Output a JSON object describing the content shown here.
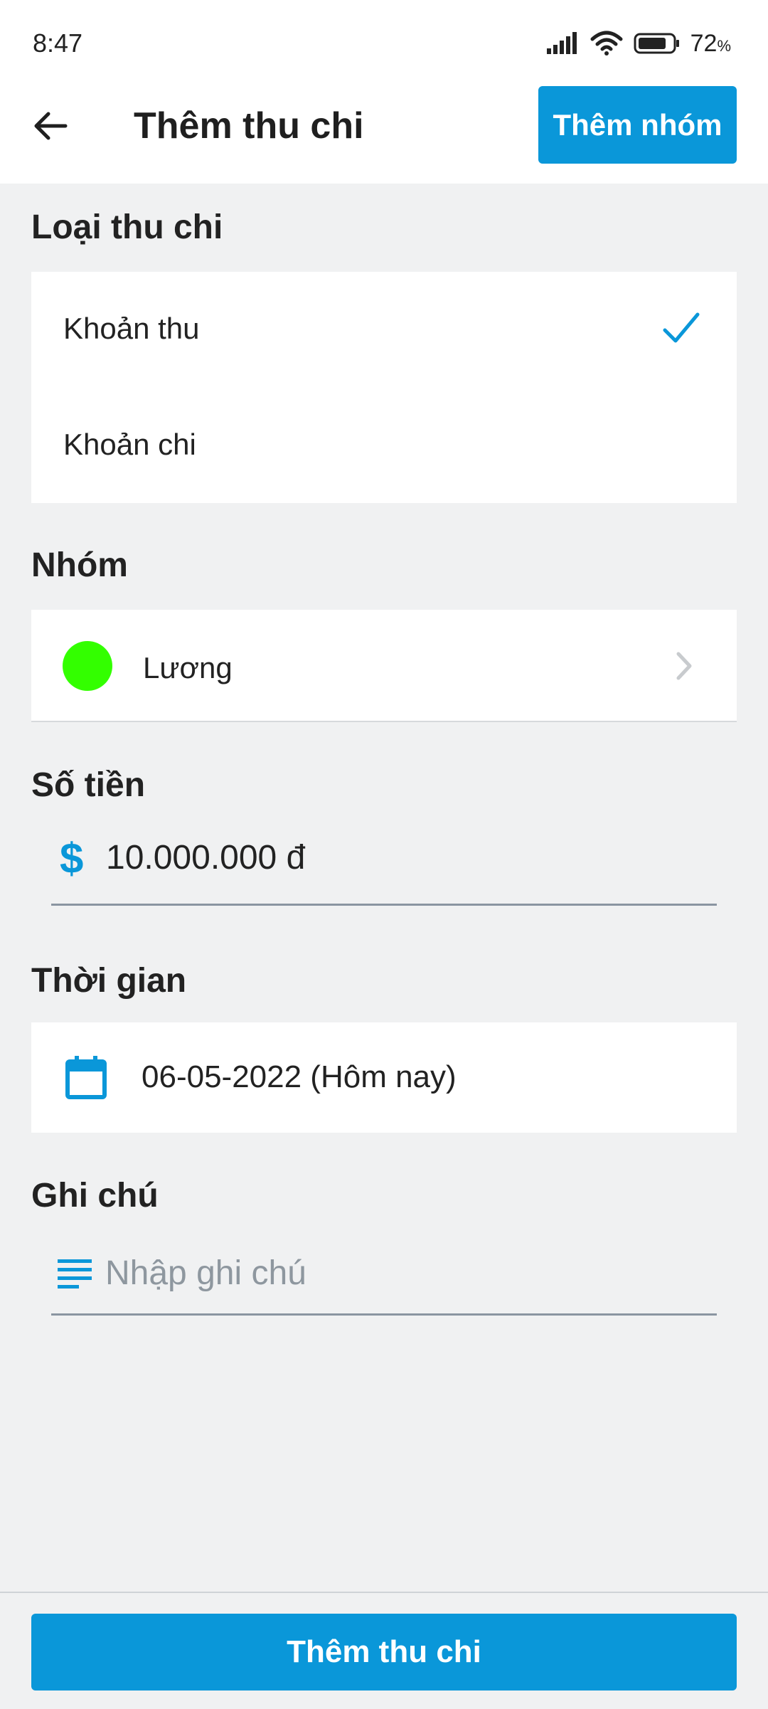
{
  "status_bar": {
    "time": "8:47",
    "battery_percent": "72",
    "battery_unit": "%"
  },
  "app_bar": {
    "title": "Thêm thu chi",
    "add_group_label": "Thêm nhóm"
  },
  "transaction_type": {
    "label": "Loại thu chi",
    "options": [
      {
        "label": "Khoản thu",
        "selected": true
      },
      {
        "label": "Khoản chi",
        "selected": false
      }
    ]
  },
  "group": {
    "label": "Nhóm",
    "name": "Lương",
    "color": "#33ff00"
  },
  "amount": {
    "label": "Số tiền",
    "value": "10.000.000 đ"
  },
  "time": {
    "label": "Thời gian",
    "value": "06-05-2022 (Hôm nay)"
  },
  "note": {
    "label": "Ghi chú",
    "placeholder": "Nhập ghi chú",
    "value": ""
  },
  "submit": {
    "label": "Thêm thu chi"
  },
  "colors": {
    "accent": "#0a97d9",
    "background": "#f0f1f2"
  }
}
